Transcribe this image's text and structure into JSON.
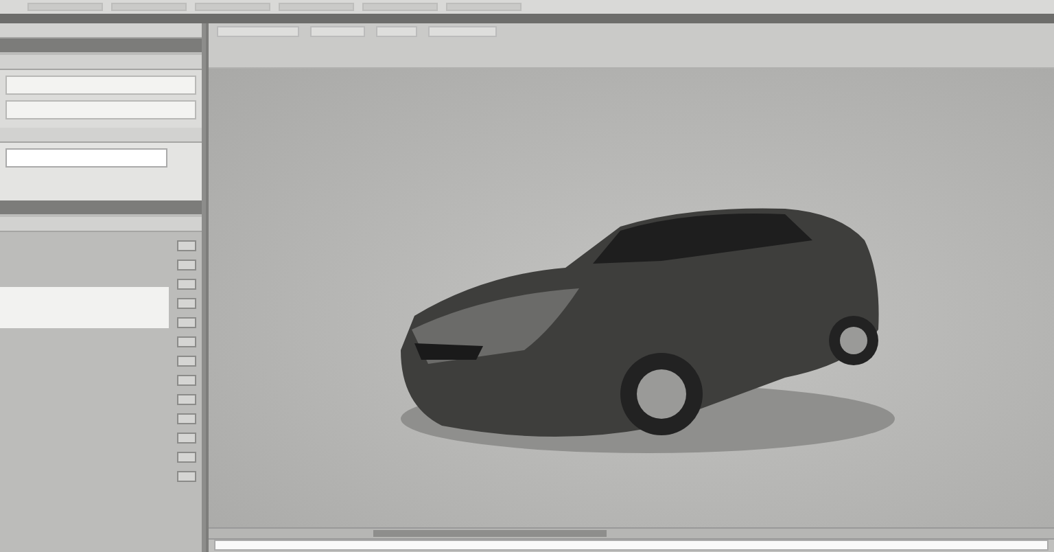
{
  "menu_bar": {
    "items": [
      {
        "kind": "field"
      },
      {
        "kind": "field"
      },
      {
        "kind": "field"
      },
      {
        "kind": "field"
      },
      {
        "kind": "field"
      },
      {
        "kind": "field"
      }
    ]
  },
  "left_panel": {
    "sections": [
      {
        "kind": "header"
      },
      {
        "kind": "dark"
      },
      {
        "kind": "header"
      },
      {
        "kind": "form"
      },
      {
        "kind": "header"
      },
      {
        "kind": "field-area"
      },
      {
        "kind": "dark"
      },
      {
        "kind": "header"
      },
      {
        "kind": "tools"
      }
    ]
  },
  "tool_buttons": [
    {
      "kind": "icon"
    },
    {
      "kind": "icon"
    },
    {
      "kind": "icon"
    },
    {
      "kind": "icon"
    },
    {
      "kind": "icon"
    },
    {
      "kind": "icon"
    },
    {
      "kind": "icon"
    },
    {
      "kind": "icon"
    },
    {
      "kind": "icon"
    },
    {
      "kind": "icon"
    },
    {
      "kind": "icon"
    },
    {
      "kind": "icon"
    },
    {
      "kind": "icon"
    }
  ],
  "viewport": {
    "kind": "render"
  }
}
